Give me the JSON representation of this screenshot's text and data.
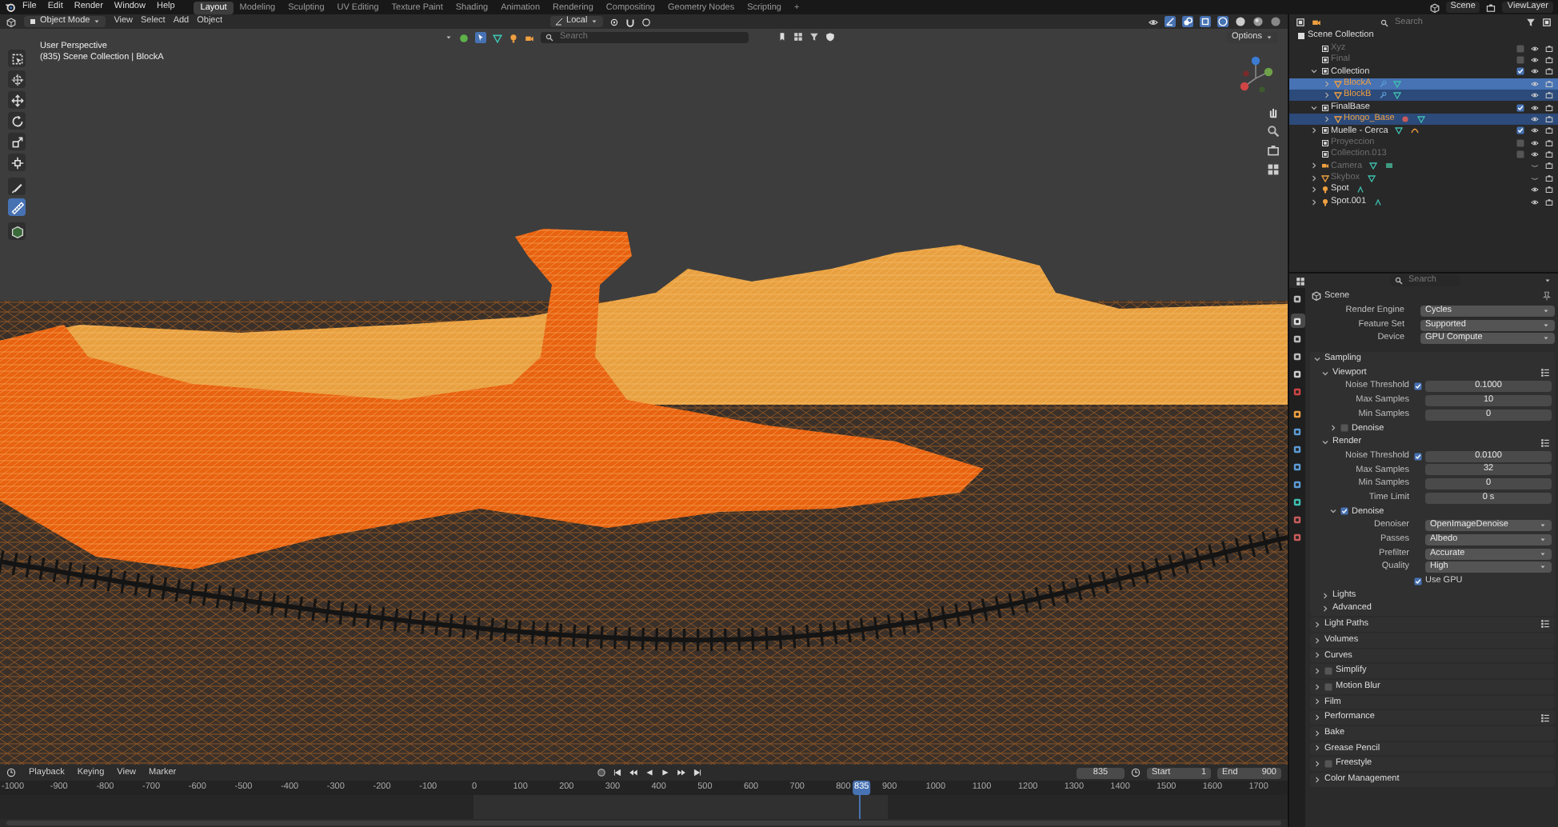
{
  "top_bar": {
    "menus": [
      "File",
      "Edit",
      "Render",
      "Window",
      "Help"
    ],
    "workspaces": [
      {
        "label": "Layout",
        "selected": true
      },
      {
        "label": "Modeling",
        "selected": false
      },
      {
        "label": "Sculpting",
        "selected": false
      },
      {
        "label": "UV Editing",
        "selected": false
      },
      {
        "label": "Texture Paint",
        "selected": false
      },
      {
        "label": "Shading",
        "selected": false
      },
      {
        "label": "Animation",
        "selected": false
      },
      {
        "label": "Rendering",
        "selected": false
      },
      {
        "label": "Compositing",
        "selected": false
      },
      {
        "label": "Geometry Nodes",
        "selected": false
      },
      {
        "label": "Scripting",
        "selected": false
      }
    ],
    "add_workspace": "+",
    "scene": "Scene",
    "view_layer": "ViewLayer"
  },
  "viewport_header": {
    "mode": "Object Mode",
    "menus": [
      "View",
      "Select",
      "Add",
      "Object"
    ],
    "orientation": "Local",
    "search": {
      "placeholder": "Search"
    },
    "options": "Options"
  },
  "viewport": {
    "info_lines": [
      "User Perspective",
      "(835) Scene Collection | BlockA"
    ],
    "tools": [
      {
        "kind": "select",
        "selected": false
      },
      {
        "kind": "cursor",
        "selected": false
      },
      {
        "kind": "move",
        "selected": false
      },
      {
        "kind": "rotate",
        "selected": false
      },
      {
        "kind": "scale",
        "selected": false
      },
      {
        "kind": "transform",
        "selected": false
      },
      {
        "kind": "annotate",
        "selected": false
      },
      {
        "kind": "measure",
        "selected": true
      },
      {
        "kind": "add-cube",
        "selected": false
      }
    ]
  },
  "outliner": {
    "search": {
      "placeholder": "Search"
    },
    "root": "Scene Collection",
    "items": [
      {
        "name": "Xyz",
        "kind": "collection",
        "checked": false,
        "visible": true,
        "selected": false,
        "active": false
      },
      {
        "name": "Final",
        "kind": "collection",
        "checked": false,
        "visible": true,
        "selected": false,
        "active": false
      },
      {
        "name": "Collection",
        "kind": "collection",
        "expanded": true,
        "checked": true,
        "visible": true,
        "selected": false,
        "active": false,
        "children": [
          {
            "name": "BlockA",
            "kind": "mesh",
            "expanded": false,
            "visible": true,
            "selected": true,
            "active": true,
            "data_icons": [
              {
                "kind": "modifier"
              },
              {
                "kind": "mesh-data"
              }
            ]
          },
          {
            "name": "BlockB",
            "kind": "mesh",
            "expanded": false,
            "visible": true,
            "selected": true,
            "active": false,
            "data_icons": [
              {
                "kind": "modifier"
              },
              {
                "kind": "mesh-data"
              }
            ]
          }
        ]
      },
      {
        "name": "FinalBase",
        "kind": "collection",
        "expanded": true,
        "checked": true,
        "visible": true,
        "selected": false,
        "active": false,
        "children": [
          {
            "name": "Hongo_Base",
            "kind": "mesh",
            "expanded": false,
            "visible": true,
            "selected": true,
            "active": false,
            "data_icons": [
              {
                "kind": "material"
              },
              {
                "kind": "mesh-data"
              }
            ]
          }
        ]
      },
      {
        "name": "Muelle - Cerca",
        "kind": "collection",
        "expanded": false,
        "checked": true,
        "visible": true,
        "selected": false,
        "active": false,
        "data_icons": [
          {
            "kind": "mesh-data"
          },
          {
            "kind": "curve"
          }
        ]
      },
      {
        "name": "Proyeccion",
        "kind": "collection",
        "checked": false,
        "visible": true,
        "selected": false,
        "active": false
      },
      {
        "name": "Collection.013",
        "kind": "collection",
        "checked": false,
        "visible": true,
        "selected": false,
        "active": false
      },
      {
        "name": "Camera",
        "kind": "camera",
        "expanded": false,
        "visible": false,
        "selected": false,
        "active": false,
        "data_icons": [
          {
            "kind": "mesh-data"
          },
          {
            "kind": "camera-data"
          }
        ]
      },
      {
        "name": "Skybox",
        "kind": "mesh",
        "expanded": false,
        "visible": false,
        "selected": false,
        "active": false,
        "data_icons": [
          {
            "kind": "mesh-data"
          }
        ]
      },
      {
        "name": "Spot",
        "kind": "light",
        "expanded": false,
        "visible": true,
        "selected": false,
        "active": false,
        "data_icons": [
          {
            "kind": "light-data"
          }
        ]
      },
      {
        "name": "Spot.001",
        "kind": "light",
        "expanded": false,
        "visible": true,
        "selected": false,
        "active": false,
        "data_icons": [
          {
            "kind": "light-data"
          }
        ]
      }
    ]
  },
  "properties": {
    "search": {
      "placeholder": "Search"
    },
    "context": "Scene",
    "tabs": [
      {
        "kind": "tool",
        "selected": false
      },
      {
        "kind": "render",
        "selected": true
      },
      {
        "kind": "output",
        "selected": false
      },
      {
        "kind": "view-layer",
        "selected": false
      },
      {
        "kind": "scene",
        "selected": false
      },
      {
        "kind": "world",
        "selected": false
      },
      {
        "kind": "object",
        "selected": false
      },
      {
        "kind": "modifiers",
        "selected": false
      },
      {
        "kind": "particles",
        "selected": false
      },
      {
        "kind": "physics",
        "selected": false
      },
      {
        "kind": "constraints",
        "selected": false
      },
      {
        "kind": "data",
        "selected": false
      },
      {
        "kind": "material",
        "selected": false
      },
      {
        "kind": "texture",
        "selected": false
      }
    ],
    "fields": [
      {
        "label": "Render Engine",
        "value": "Cycles",
        "kind": "dropdown"
      },
      {
        "label": "Feature Set",
        "value": "Supported",
        "kind": "dropdown"
      },
      {
        "label": "Device",
        "value": "GPU Compute",
        "kind": "dropdown"
      }
    ],
    "panels": [
      {
        "title": "Sampling",
        "expanded": true,
        "children": [
          {
            "title": "Viewport",
            "expanded": true,
            "has_presets": true,
            "fields": [
              {
                "label": "Noise Threshold",
                "checked": true,
                "value": "0.1000",
                "kind": "number"
              },
              {
                "label": "Max Samples",
                "value": "10",
                "kind": "number"
              },
              {
                "label": "Min Samples",
                "value": "0",
                "kind": "number"
              }
            ],
            "children": [
              {
                "title": "Denoise",
                "expanded": false,
                "checked": false
              }
            ]
          },
          {
            "title": "Render",
            "expanded": true,
            "has_presets": true,
            "fields": [
              {
                "label": "Noise Threshold",
                "checked": true,
                "value": "0.0100",
                "kind": "number"
              },
              {
                "label": "Max Samples",
                "value": "32",
                "kind": "number"
              },
              {
                "label": "Min Samples",
                "value": "0",
                "kind": "number"
              },
              {
                "label": "Time Limit",
                "value": "0 s",
                "kind": "number"
              }
            ],
            "children": [
              {
                "title": "Denoise",
                "expanded": true,
                "checked": true,
                "fields": [
                  {
                    "label": "Denoiser",
                    "value": "OpenImageDenoise",
                    "kind": "dropdown"
                  },
                  {
                    "label": "Passes",
                    "value": "Albedo",
                    "kind": "dropdown"
                  },
                  {
                    "label": "Prefilter",
                    "value": "Accurate",
                    "kind": "dropdown"
                  },
                  {
                    "label": "Quality",
                    "value": "High",
                    "kind": "dropdown"
                  }
                ],
                "options": [
                  {
                    "label": "Use GPU",
                    "checked": true
                  }
                ]
              }
            ]
          },
          {
            "title": "Lights",
            "expanded": false
          },
          {
            "title": "Advanced",
            "expanded": false
          }
        ]
      },
      {
        "title": "Light Paths",
        "expanded": false,
        "has_presets": true
      },
      {
        "title": "Volumes",
        "expanded": false
      },
      {
        "title": "Curves",
        "expanded": false
      },
      {
        "title": "Simplify",
        "expanded": false,
        "checked": false
      },
      {
        "title": "Motion Blur",
        "expanded": false,
        "checked": false
      },
      {
        "title": "Film",
        "expanded": false
      },
      {
        "title": "Performance",
        "expanded": false,
        "has_presets": true
      },
      {
        "title": "Bake",
        "expanded": false
      },
      {
        "title": "Grease Pencil",
        "expanded": false
      },
      {
        "title": "Freestyle",
        "expanded": false,
        "checked": false
      },
      {
        "title": "Color Management",
        "expanded": false
      }
    ]
  },
  "timeline": {
    "menus": [
      "Playback",
      "Keying",
      "View",
      "Marker"
    ],
    "current_frame": "835",
    "start_label": "Start",
    "start": "1",
    "end_label": "End",
    "end": "900",
    "ruler": [
      "-1000",
      "-900",
      "-800",
      "-700",
      "-600",
      "-500",
      "-400",
      "-300",
      "-200",
      "-100",
      "0",
      "100",
      "200",
      "300",
      "400",
      "500",
      "600",
      "700",
      "800",
      "900",
      "1000",
      "1100",
      "1200",
      "1300",
      "1400",
      "1500",
      "1600",
      "1700"
    ],
    "playhead": {
      "label": "835",
      "level": 0.667
    }
  }
}
